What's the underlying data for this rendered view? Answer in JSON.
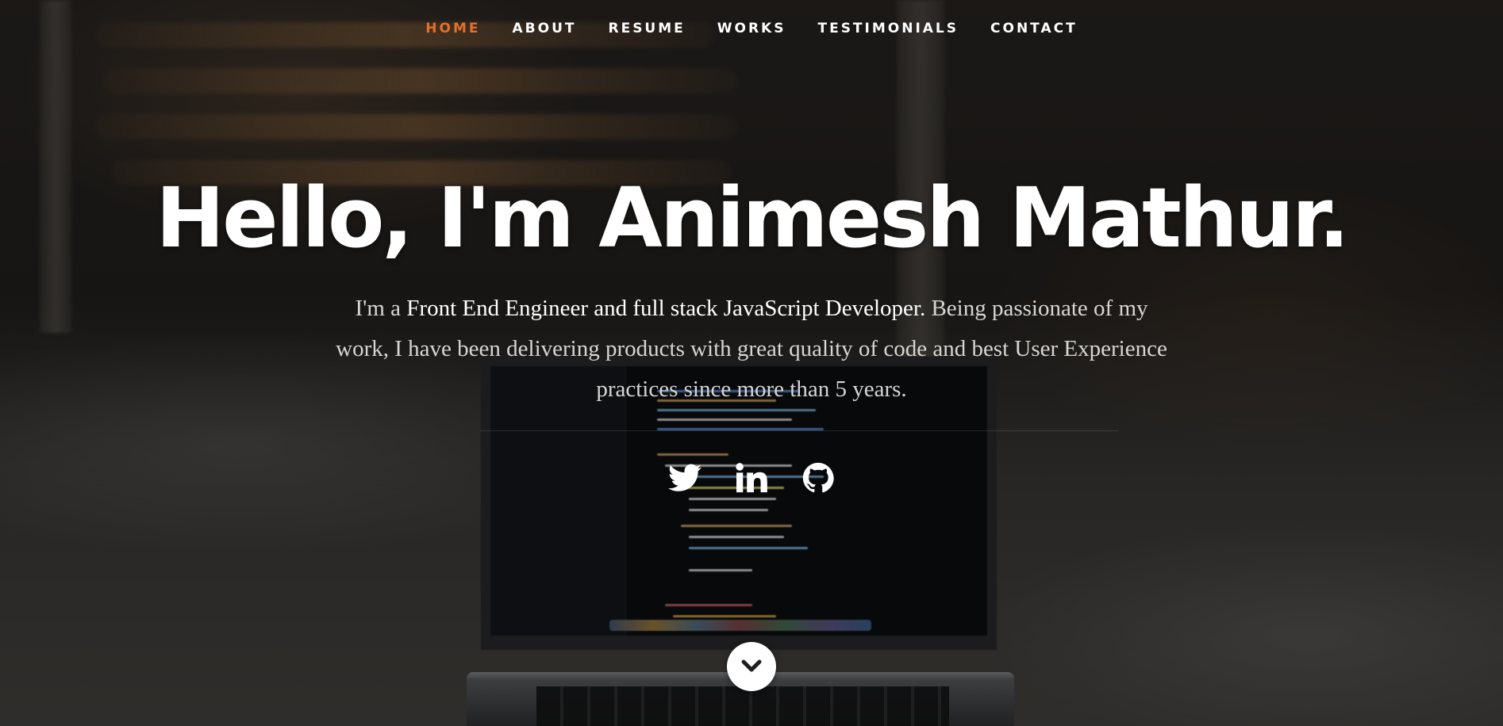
{
  "nav": {
    "items": [
      {
        "label": "HOME",
        "current": true
      },
      {
        "label": "ABOUT",
        "current": false
      },
      {
        "label": "RESUME",
        "current": false
      },
      {
        "label": "WORKS",
        "current": false
      },
      {
        "label": "TESTIMONIALS",
        "current": false
      },
      {
        "label": "CONTACT",
        "current": false
      }
    ],
    "accent_color": "#e3702d"
  },
  "banner": {
    "headline": "Hello, I'm Animesh Mathur.",
    "intro_prefix": "I'm a ",
    "intro_role": "Front End Engineer and full stack JavaScript Developer.",
    "intro_rest": " Being passionate of my work, I have been delivering products with great quality of code and best User Experience practices since more than 5 years."
  },
  "social": [
    {
      "icon": "twitter-icon"
    },
    {
      "icon": "linkedin-icon"
    },
    {
      "icon": "github-icon"
    }
  ],
  "scroll_down": {
    "icon": "chevron-down-icon"
  }
}
